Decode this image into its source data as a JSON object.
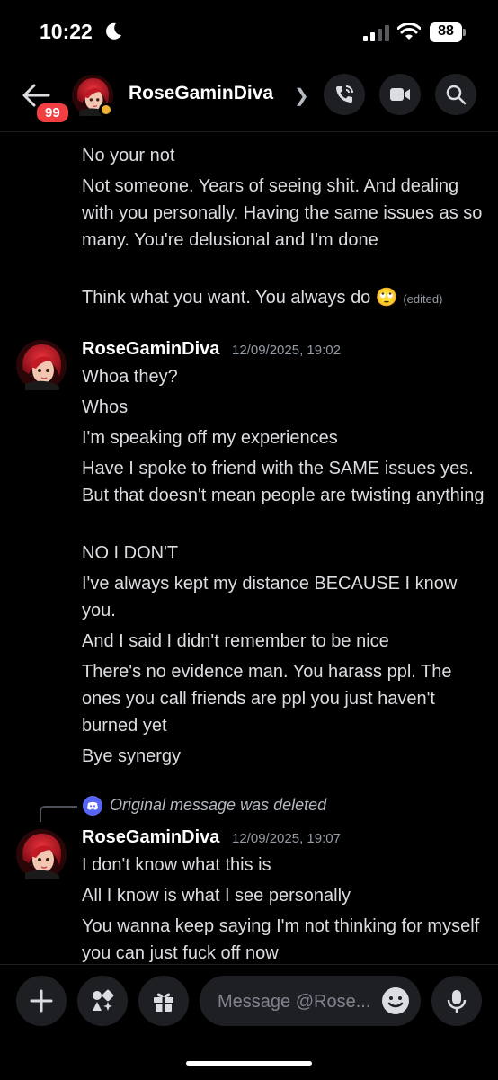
{
  "status": {
    "time": "10:22",
    "battery": "88"
  },
  "header": {
    "back_badge": "99",
    "username": "RoseGaminDiva"
  },
  "messages_top": [
    "No your not",
    "Not someone. Years of seeing shit. And dealing with you personally. Having the same issues as so many. You're delusional and I'm done",
    "Think what you want. You always do 🙄"
  ],
  "edited_label": "(edited)",
  "group1": {
    "author": "RoseGaminDiva",
    "timestamp": "12/09/2025, 19:02",
    "lines": [
      "Whoa they?",
      "Whos",
      "I'm speaking off my experiences",
      "Have I spoke to friend with the SAME issues yes. But that doesn't mean people are twisting anything",
      "NO I DON'T",
      "I've always kept my distance BECAUSE I know you.",
      "And I said I didn't remember to be nice",
      "There's no evidence man. You harass ppl. The ones you call friends are ppl you just haven't burned yet",
      "Bye synergy"
    ]
  },
  "group2": {
    "reply_text": "Original message was deleted",
    "author": "RoseGaminDiva",
    "timestamp": "12/09/2025, 19:07",
    "lines": [
      "I don't know what this is",
      "All I know is what I see personally",
      "You wanna keep saying I'm not thinking for myself you can just fuck off now"
    ]
  },
  "composer": {
    "placeholder": "Message @Rose..."
  },
  "colors": {
    "accent": "#5865f2",
    "badge": "#f23f43",
    "idle": "#f0b232",
    "background": "#000000"
  },
  "icons": [
    "moon-icon",
    "signal-icon",
    "wifi-icon",
    "back-arrow-icon",
    "chevron-right-icon",
    "call-icon",
    "video-icon",
    "search-icon",
    "plus-icon",
    "apps-icon",
    "gift-icon",
    "emoji-icon",
    "mic-icon",
    "discord-icon"
  ]
}
